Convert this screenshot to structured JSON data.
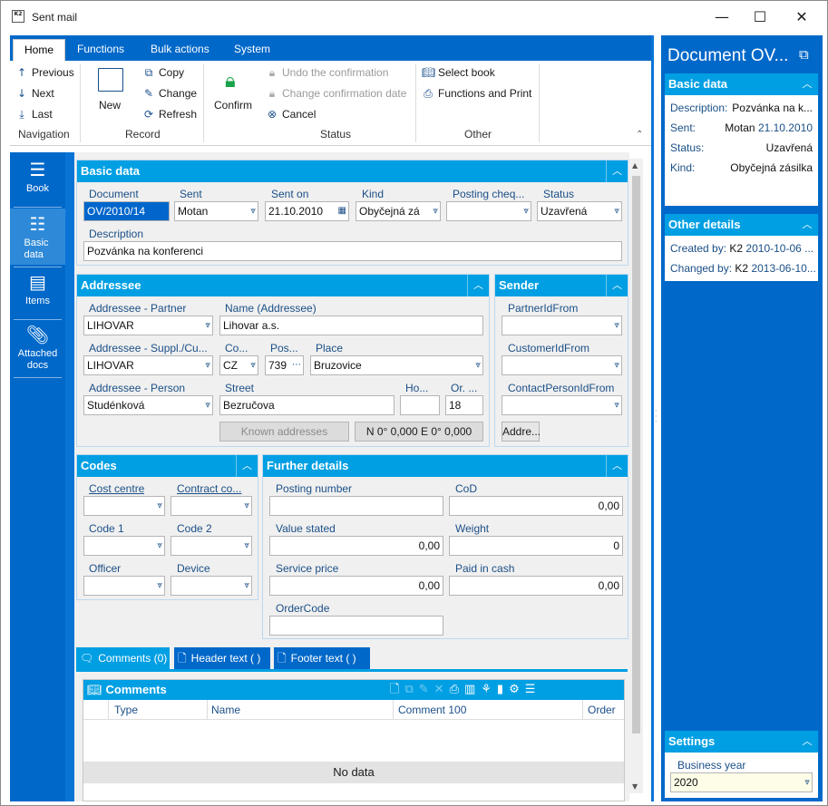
{
  "window": {
    "title": "Sent mail",
    "logo": "K2",
    "minimize": "—",
    "maximize": "☐",
    "close": "✕"
  },
  "ribbon": {
    "tabs": [
      "Home",
      "Functions",
      "Bulk actions",
      "System"
    ],
    "navigation": {
      "label": "Navigation",
      "previous": "Previous",
      "next": "Next",
      "last": "Last"
    },
    "record": {
      "label": "Record",
      "new": "New",
      "copy": "Copy",
      "change": "Change",
      "refresh": "Refresh"
    },
    "status": {
      "label": "Status",
      "confirm": "Confirm",
      "undo": "Undo the confirmation",
      "change_date": "Change confirmation date",
      "cancel": "Cancel"
    },
    "other": {
      "label": "Other",
      "select_book": "Select book",
      "functions_print": "Functions and Print"
    }
  },
  "leftnav": [
    {
      "label": "Book",
      "icon": "hamburger-icon"
    },
    {
      "label": "Basic data",
      "icon": "list-icon"
    },
    {
      "label": "Items",
      "icon": "box-icon"
    },
    {
      "label": "Attached docs",
      "icon": "paperclip-icon"
    }
  ],
  "basic": {
    "title": "Basic data",
    "document_label": "Document",
    "document": "OV/2010/14",
    "sent_label": "Sent",
    "sent": "Motan",
    "sent_on_label": "Sent on",
    "sent_on": "21.10.2010",
    "kind_label": "Kind",
    "kind": "Obyčejná zá",
    "posting_label": "Posting cheq...",
    "posting": "",
    "status_label": "Status",
    "status": "Uzavřená",
    "description_label": "Description",
    "description": "Pozvánka na konferenci"
  },
  "addressee": {
    "title": "Addressee",
    "partner_label": "Addressee - Partner",
    "partner": "LIHOVAR",
    "name_label": "Name (Addressee)",
    "name": "Lihovar a.s.",
    "suppl_label": "Addressee - Suppl./Cu...",
    "suppl": "LIHOVAR",
    "co_label": "Co...",
    "co": "CZ",
    "pos_label": "Pos...",
    "pos": "739",
    "place_label": "Place",
    "place": "Bruzovice",
    "person_label": "Addressee - Person",
    "person": "Studénková",
    "street_label": "Street",
    "street": "Bezručova",
    "ho_label": "Ho...",
    "ho": "",
    "or_label": "Or. ...",
    "or": "18",
    "known_button": "Known addresses",
    "coords": "N 0° 0,000 E 0° 0,000"
  },
  "sender": {
    "title": "Sender",
    "partner_label": "PartnerIdFrom",
    "customer_label": "CustomerIdFrom",
    "contact_label": "ContactPersonIdFrom",
    "addr_button": "Addre..."
  },
  "codes": {
    "title": "Codes",
    "cost_centre_label": "Cost centre",
    "contract_label": "Contract co...",
    "code1_label": "Code 1",
    "code2_label": "Code 2",
    "officer_label": "Officer",
    "device_label": "Device"
  },
  "further": {
    "title": "Further details",
    "posting_number_label": "Posting number",
    "posting_number": "",
    "cod_label": "CoD",
    "cod": "0,00",
    "value_label": "Value stated",
    "value": "0,00",
    "weight_label": "Weight",
    "weight": "0",
    "service_label": "Service price",
    "service": "0,00",
    "paid_label": "Paid in cash",
    "paid": "0,00",
    "ordercode_label": "OrderCode",
    "ordercode": ""
  },
  "bottom_tabs": [
    "Comments (0)",
    "Header text ( )",
    "Footer text ( )"
  ],
  "comments": {
    "title": "Comments",
    "columns": [
      "Type",
      "Name",
      "Comment 100",
      "Order"
    ],
    "empty": "No data"
  },
  "right": {
    "title": "Document OV...",
    "basic_title": "Basic data",
    "description_label": "Description:",
    "description": "Pozvánka na k...",
    "sent_label": "Sent:",
    "sent_name": "Motan",
    "sent_date": "21.10.2010",
    "status_label": "Status:",
    "status": "Uzavřená",
    "kind_label": "Kind:",
    "kind": "Obyčejná zásilka",
    "other_title": "Other details",
    "created_label": "Created by:",
    "created_user": "K2",
    "created_date": "2010-10-06 ...",
    "changed_label": "Changed by:",
    "changed_user": "K2",
    "changed_date": "2013-06-10...",
    "settings_title": "Settings",
    "year_label": "Business year",
    "year": "2020"
  }
}
